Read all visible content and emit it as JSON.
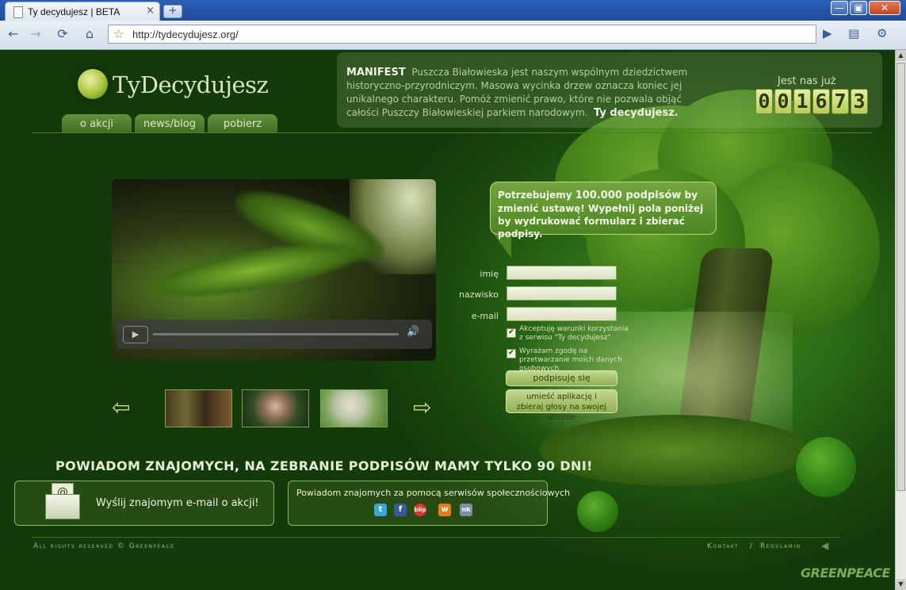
{
  "browser": {
    "tab_title": "Ty decydujesz | BETA",
    "tab_close": "×",
    "new_tab": "+",
    "win_min": "—",
    "win_max": "▣",
    "win_close": "✕",
    "url": "http://tydecydujesz.org/",
    "nav": {
      "back": "←",
      "forward": "→",
      "reload": "⟳",
      "home": "⌂",
      "star": "☆",
      "go": "▶",
      "page": "▤",
      "tools": "⚙"
    }
  },
  "site": {
    "logo": "TyDecydujesz",
    "nav": [
      "o akcji",
      "news/blog",
      "pobierz"
    ],
    "manifest": {
      "label": "MANIFEST",
      "text": "Puszcza Białowieska jest naszym wspólnym dziedzictwem historyczno-przyrodniczym. Masowa wycinka drzew oznacza koniec jej unikalnego charakteru. Pomóż zmienić prawo, które nie pozwala objąć całości Puszczy Białowieskiej parkiem narodowym.",
      "closing": "Ty decydujesz."
    },
    "counter": {
      "label": "Jest nas już",
      "digits": [
        "0",
        "0",
        "1",
        "6",
        "7",
        "3"
      ]
    },
    "video": {
      "play": "▶",
      "volume": "🔊"
    },
    "carousel": {
      "prev": "⇦",
      "next": "⇨"
    },
    "bubble": {
      "prefix": "Potrzebujemy",
      "highlight": "100.000 podpisów",
      "rest": "by zmienić ustawę! Wypełnij pola poniżej by wydrukować formularz i zbierać podpisy."
    },
    "form": {
      "name_label": "imię",
      "surname_label": "nazwisko",
      "email_label": "e-mail",
      "name_value": "",
      "surname_value": "",
      "email_value": "",
      "check1": "Akceptuję warunki korzystania z serwisu \"Ty decydujesz\"",
      "check2": "Wyrażam zgodę na przetwarzanie moich danych osobowych",
      "check_mark": "✔",
      "sign_button": "podpisuję się",
      "embed_button": "umieść aplikację i zbieraj głosy na swojej stronie"
    },
    "notify_heading": "POWIADOM ZNAJOMYCH, NA ZEBRANIE PODPISÓW MAMY TYLKO 90 DNI!",
    "email_panel": {
      "icon": "@",
      "text": "Wyślij znajomym e-mail o akcji!"
    },
    "social_panel": {
      "text": "Powiadom znajomych za pomocą serwisów społecznościowych",
      "icons": [
        "twitter-icon",
        "facebook-icon",
        "blip-icon",
        "wykop-icon",
        "nk-icon"
      ],
      "letters": [
        "t",
        "f",
        "blip",
        "w",
        "nk"
      ]
    },
    "footer": {
      "copyright": "All rights reserved © Greenpeace",
      "contact": "Kontakt",
      "separator": "/",
      "rules": "Regulamin",
      "brand": "GREENPEACE"
    }
  }
}
